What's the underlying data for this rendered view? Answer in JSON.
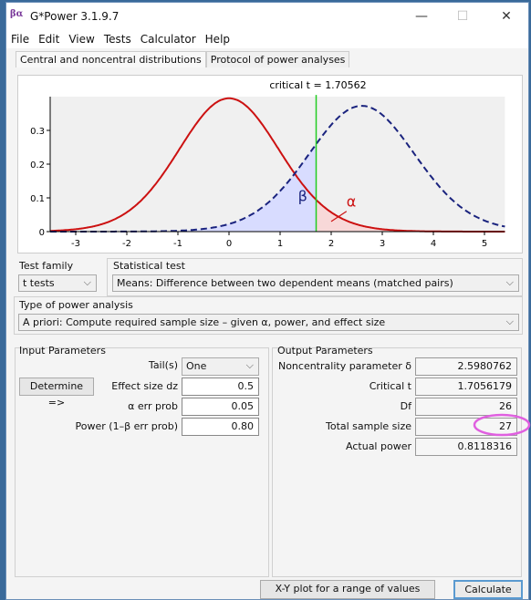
{
  "window": {
    "title": "G*Power 3.1.9.7",
    "logo": "βα",
    "minimize": "—",
    "maximize": "☐",
    "close": "✕"
  },
  "menu": [
    "File",
    "Edit",
    "View",
    "Tests",
    "Calculator",
    "Help"
  ],
  "tabs": [
    "Central and noncentral distributions",
    "Protocol of power analyses"
  ],
  "plot": {
    "critical_label": "critical t =  1.70562",
    "beta": "β",
    "alpha": "α"
  },
  "chart_data": {
    "type": "line",
    "x_ticks": [
      "-3",
      "-2",
      "-1",
      "0",
      "1",
      "2",
      "3",
      "4",
      "5"
    ],
    "y_ticks": [
      "0",
      "0.1",
      "0.2",
      "0.3"
    ],
    "xlim": [
      -3.5,
      5.4
    ],
    "ylim": [
      0,
      0.4
    ],
    "critical_t": 1.70562,
    "df": 26,
    "noncentrality": 2.5980762,
    "colors": {
      "central": "#cc1111",
      "noncentral": "#1a237e",
      "critical": "#22cc22",
      "beta_fill": "#d8dcff",
      "alpha_fill": "#f8d8d8"
    }
  },
  "test_family": {
    "label": "Test family",
    "value": "t tests"
  },
  "statistical_test": {
    "label": "Statistical test",
    "value": "Means: Difference between two dependent means (matched pairs)"
  },
  "analysis_type": {
    "label": "Type of power analysis",
    "value": "A priori: Compute required sample size – given α, power, and effect size"
  },
  "input": {
    "title": "Input Parameters",
    "determine": "Determine =>",
    "rows": [
      {
        "label": "Tail(s)",
        "value": "One"
      },
      {
        "label": "Effect size dz",
        "value": "0.5"
      },
      {
        "label": "α err prob",
        "value": "0.05"
      },
      {
        "label": "Power (1–β err prob)",
        "value": "0.80"
      }
    ]
  },
  "output": {
    "title": "Output Parameters",
    "rows": [
      {
        "label": "Noncentrality parameter δ",
        "value": "2.5980762"
      },
      {
        "label": "Critical t",
        "value": "1.7056179"
      },
      {
        "label": "Df",
        "value": "26"
      },
      {
        "label": "Total sample size",
        "value": "27"
      },
      {
        "label": "Actual power",
        "value": "0.8118316"
      }
    ]
  },
  "buttons": {
    "xy_plot": "X-Y plot for a range of values",
    "calculate": "Calculate"
  }
}
